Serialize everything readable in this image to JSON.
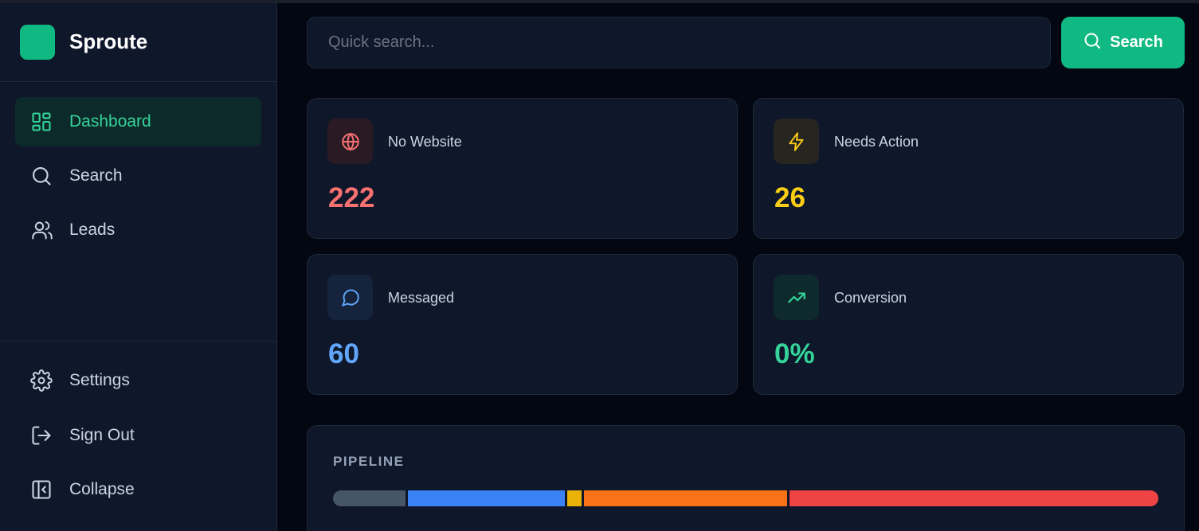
{
  "brand": {
    "name": "Sproute",
    "logo_color": "#10b981"
  },
  "sidebar": {
    "nav": [
      {
        "label": "Dashboard",
        "icon": "dashboard-icon",
        "active": true
      },
      {
        "label": "Search",
        "icon": "search-icon",
        "active": false
      },
      {
        "label": "Leads",
        "icon": "users-icon",
        "active": false
      }
    ],
    "bottom": [
      {
        "label": "Settings",
        "icon": "gear-icon"
      },
      {
        "label": "Sign Out",
        "icon": "sign-out-icon"
      },
      {
        "label": "Collapse",
        "icon": "collapse-icon"
      }
    ]
  },
  "search": {
    "placeholder": "Quick search...",
    "button_label": "Search"
  },
  "stats": [
    {
      "label": "No Website",
      "value": "222",
      "icon": "globe-icon",
      "color": "#f87171"
    },
    {
      "label": "Needs Action",
      "value": "26",
      "icon": "lightning-icon",
      "color": "#facc15"
    },
    {
      "label": "Messaged",
      "value": "60",
      "icon": "message-icon",
      "color": "#60a5fa"
    },
    {
      "label": "Conversion",
      "value": "0%",
      "icon": "trending-up-icon",
      "color": "#34d399"
    }
  ],
  "pipeline": {
    "title": "PIPELINE",
    "segments": [
      {
        "color": "#475569",
        "share": 8.9
      },
      {
        "color": "#3b82f6",
        "share": 19.2
      },
      {
        "color": "#eab308",
        "share": 1.8
      },
      {
        "color": "#f97316",
        "share": 24.9
      },
      {
        "color": "#ef4444",
        "share": 45.2
      }
    ]
  },
  "colors": {
    "accent": "#10b981",
    "background": "#030712",
    "panel": "#0f172a"
  }
}
